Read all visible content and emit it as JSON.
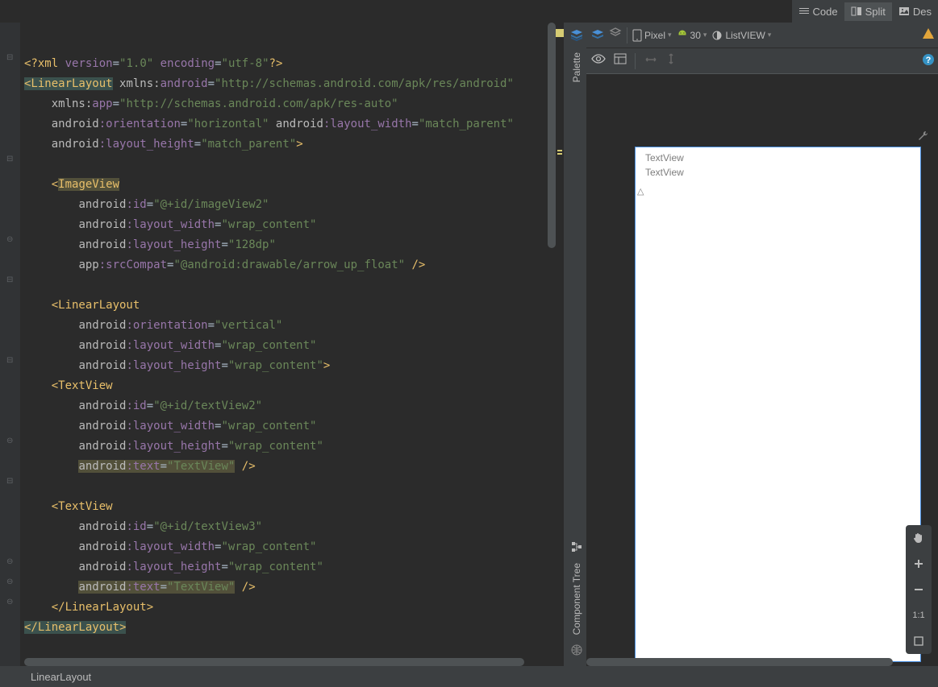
{
  "tabs": {
    "code": "Code",
    "split": "Split",
    "design": "Des"
  },
  "code": {
    "l1": {
      "a": "<?xml",
      "b": "version",
      "c": "\"1.0\"",
      "d": "encoding",
      "e": "\"utf-8\"",
      "f": "?>"
    },
    "l2": {
      "a": "<LinearLayout",
      "b": "xmlns:",
      "c": "android",
      "d": "\"http://schemas.android.com/apk/res/android\""
    },
    "l3": {
      "a": "xmlns:",
      "b": "app",
      "c": "\"http://schemas.android.com/apk/res-auto\""
    },
    "l4": {
      "a": "android",
      "b": ":orientation",
      "c": "\"horizontal\"",
      "d": "android",
      "e": ":layout_width",
      "f": "\"match_parent\""
    },
    "l5": {
      "a": "android",
      "b": ":layout_height",
      "c": "\"match_parent\"",
      "d": ">"
    },
    "l7": {
      "a": "<",
      "b": "ImageView"
    },
    "l8": {
      "a": "android",
      "b": ":id",
      "c": "\"@+id/imageView2\""
    },
    "l9": {
      "a": "android",
      "b": ":layout_width",
      "c": "\"wrap_content\""
    },
    "l10": {
      "a": "android",
      "b": ":layout_height",
      "c": "\"128dp\""
    },
    "l11": {
      "a": "app",
      "b": ":srcCompat",
      "c": "\"@android:drawable/arrow_up_float\"",
      "d": " />"
    },
    "l13": {
      "a": "<LinearLayout"
    },
    "l14": {
      "a": "android",
      "b": ":orientation",
      "c": "\"vertical\""
    },
    "l15": {
      "a": "android",
      "b": ":layout_width",
      "c": "\"wrap_content\""
    },
    "l16": {
      "a": "android",
      "b": ":layout_height",
      "c": "\"wrap_content\"",
      "d": ">"
    },
    "l17": {
      "a": "<TextView"
    },
    "l18": {
      "a": "android",
      "b": ":id",
      "c": "\"@+id/textView2\""
    },
    "l19": {
      "a": "android",
      "b": ":layout_width",
      "c": "\"wrap_content\""
    },
    "l20": {
      "a": "android",
      "b": ":layout_height",
      "c": "\"wrap_content\""
    },
    "l21": {
      "a": "android",
      "b": ":text",
      "c": "\"TextView\"",
      "d": " />"
    },
    "l23": {
      "a": "<TextView"
    },
    "l24": {
      "a": "android",
      "b": ":id",
      "c": "\"@+id/textView3\""
    },
    "l25": {
      "a": "android",
      "b": ":layout_width",
      "c": "\"wrap_content\""
    },
    "l26": {
      "a": "android",
      "b": ":layout_height",
      "c": "\"wrap_content\""
    },
    "l27": {
      "a": "android",
      "b": ":text",
      "c": "\"TextView\"",
      "d": " />"
    },
    "l28": {
      "a": "</LinearLayout>"
    },
    "l29": {
      "a": "</LinearLayout>"
    }
  },
  "side": {
    "palette": "Palette",
    "componentTree": "Component Tree"
  },
  "toolbar": {
    "device": "Pixel",
    "api": "30",
    "theme": "ListVIEW",
    "more": "»"
  },
  "preview": {
    "tv1": "TextView",
    "tv2": "TextView",
    "arrow": "△"
  },
  "zoom": {
    "oneToOne": "1:1"
  },
  "status": {
    "breadcrumb": "LinearLayout"
  }
}
